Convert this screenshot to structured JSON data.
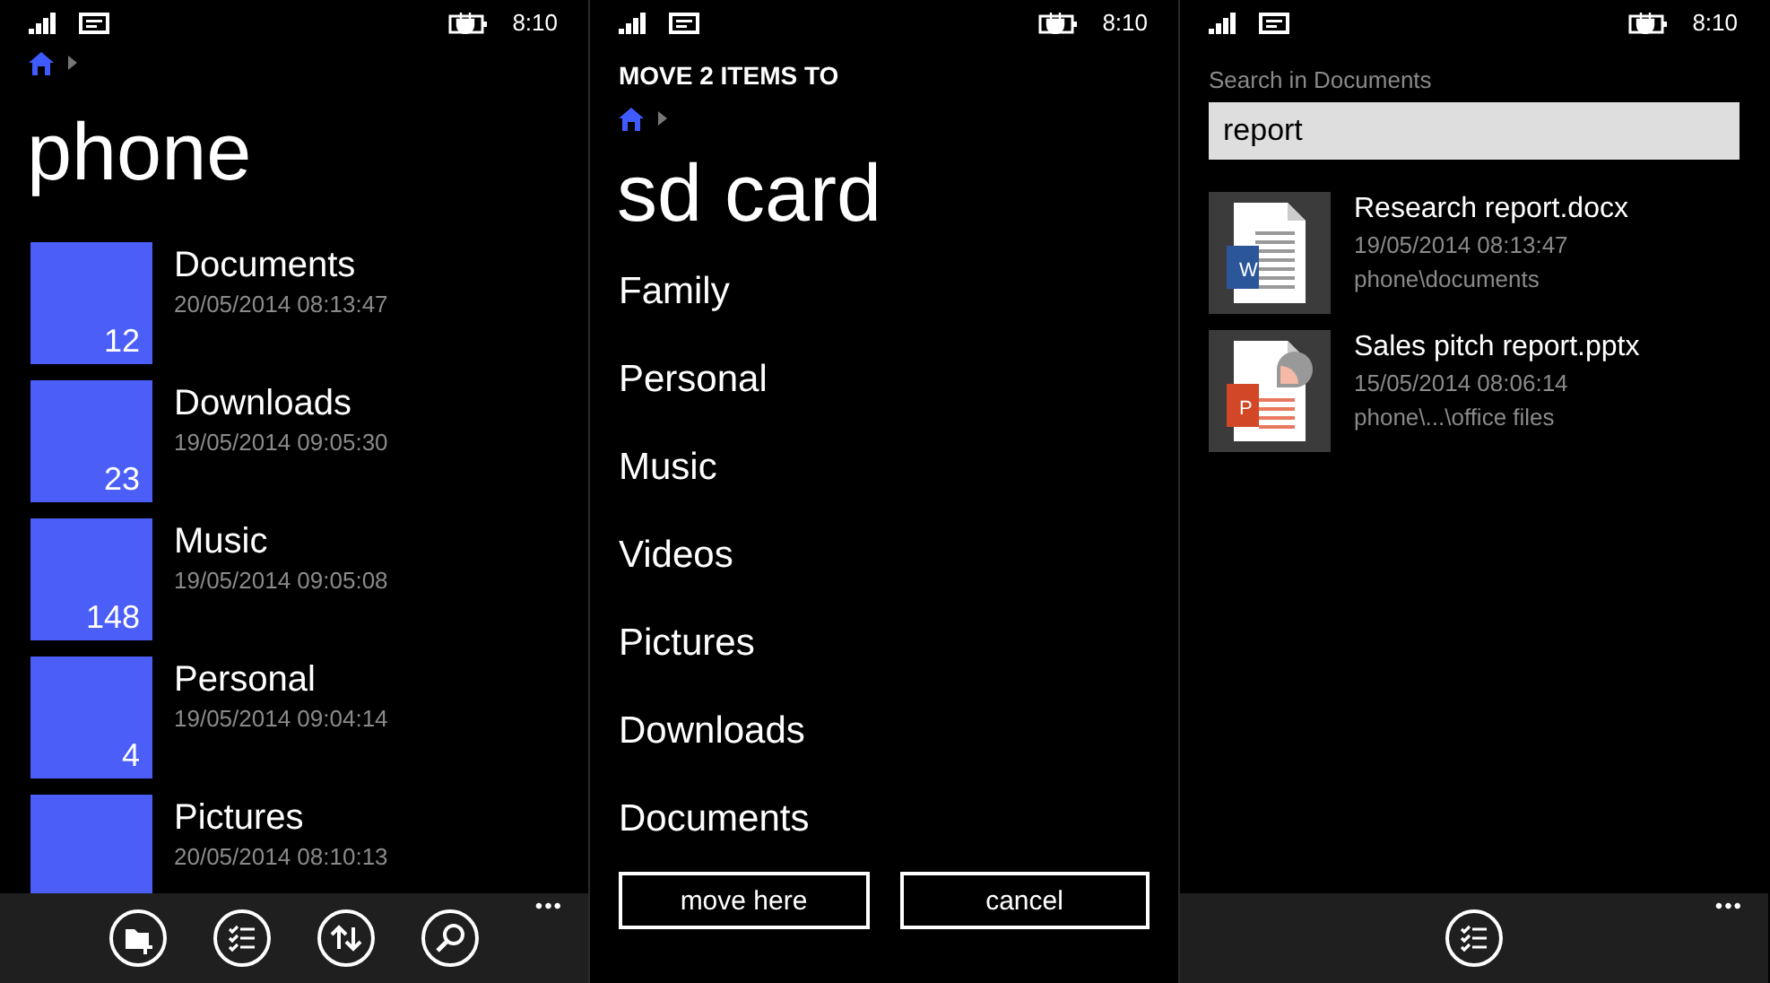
{
  "browse_screen": {
    "status": {
      "time": "8:10"
    },
    "title": "phone",
    "folders": [
      {
        "name": "Documents",
        "modified": "20/05/2014 08:13:47",
        "count": "12"
      },
      {
        "name": "Downloads",
        "modified": "19/05/2014 09:05:30",
        "count": "23"
      },
      {
        "name": "Music",
        "modified": "19/05/2014 09:05:08",
        "count": "148"
      },
      {
        "name": "Personal",
        "modified": "19/05/2014 09:04:14",
        "count": "4"
      },
      {
        "name": "Pictures",
        "modified": "20/05/2014 08:10:13"
      }
    ],
    "app_bar": {
      "buttons": [
        {
          "kind": "new-folder"
        },
        {
          "kind": "select"
        },
        {
          "kind": "sort"
        },
        {
          "kind": "search"
        }
      ],
      "more": "•••"
    }
  },
  "move_screen": {
    "status": {
      "time": "8:10"
    },
    "heading": "MOVE 2 ITEMS TO",
    "title": "sd card",
    "folders": [
      "Family",
      "Personal",
      "Music",
      "Videos",
      "Pictures",
      "Downloads",
      "Documents"
    ],
    "buttons": [
      "move here",
      "cancel"
    ]
  },
  "search_screen": {
    "status": {
      "time": "8:10"
    },
    "label": "Search in Documents",
    "search": {
      "value": "report"
    },
    "results": [
      {
        "kind": "word",
        "badge": "W",
        "name": "Research report.docx",
        "modified": "19/05/2014 08:13:47",
        "path": "phone\\documents"
      },
      {
        "kind": "powerpoint",
        "badge": "P",
        "name": "Sales pitch report.pptx",
        "modified": "15/05/2014 08:06:14",
        "path": "phone\\...\\office files"
      }
    ],
    "app_bar": {
      "buttons": [
        {
          "kind": "select"
        }
      ],
      "more": "•••"
    }
  }
}
